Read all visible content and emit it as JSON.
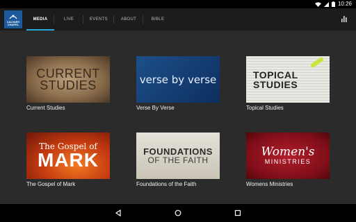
{
  "status_bar": {
    "time": "10:26",
    "icons": [
      "wifi-icon",
      "signal-icon",
      "battery-icon"
    ]
  },
  "app": {
    "logo_text_line1": "CALVARY",
    "logo_text_line2": "CHAPEL",
    "tabs": [
      {
        "label": "MEDIA",
        "active": true
      },
      {
        "label": "LIVE",
        "active": false
      },
      {
        "label": "EVENTS",
        "active": false
      },
      {
        "label": "ABOUT",
        "active": false
      },
      {
        "label": "BIBLE",
        "active": false
      }
    ],
    "stats_icon": "bar-chart-icon",
    "accent_color": "#29a8e0"
  },
  "cards": [
    {
      "caption": "Current Studies",
      "art_line1": "CURRENT",
      "art_line2": "STUDIES"
    },
    {
      "caption": "Verse By Verse",
      "art_line1": "verse by verse"
    },
    {
      "caption": "Topical Studies",
      "art_line1": "TOPICAL",
      "art_line2": "STUDIES"
    },
    {
      "caption": "The Gospel of Mark",
      "art_line1": "The Gospel of",
      "art_line2": "MARK"
    },
    {
      "caption": "Foundations of the Faith",
      "art_line1": "FOUNDATIONS",
      "art_line2": "OF THE FAITH"
    },
    {
      "caption": "Womens Ministries",
      "art_line1": "Women's",
      "art_line2": "MINISTRIES"
    }
  ],
  "nav_bar": {
    "icons": [
      "back-icon",
      "home-icon",
      "recents-icon"
    ]
  }
}
